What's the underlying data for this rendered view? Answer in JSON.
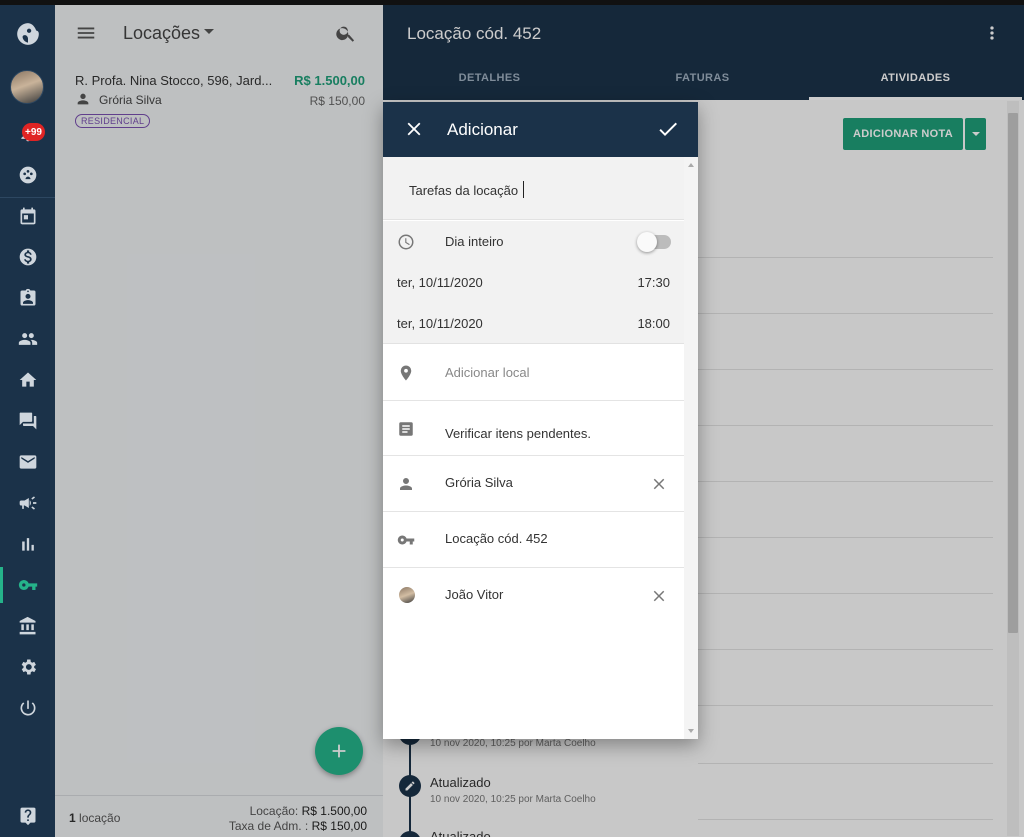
{
  "sidebar": {
    "notifications_badge": "+99",
    "active_item": "locacoes"
  },
  "list": {
    "title": "Locações",
    "items": [
      {
        "address": "R. Profa. Nina Stocco, 596, Jard...",
        "price": "R$ 1.500,00",
        "person": "Grória Silva",
        "fee": "R$ 150,00",
        "tag": "RESIDENCIAL"
      }
    ],
    "footer": {
      "count_number": "1",
      "count_label": "locação",
      "rent_label": "Locação:",
      "rent_value": "R$ 1.500,00",
      "fee_label": "Taxa de Adm. :",
      "fee_value": "R$ 150,00"
    }
  },
  "detail": {
    "title": "Locação cód. 452",
    "tabs": [
      "DETALHES",
      "FATURAS",
      "ATIVIDADES"
    ],
    "active_tab": "ATIVIDADES",
    "add_note_label": "ADICIONAR NOTA",
    "timeline": [
      {
        "title": "",
        "meta": "10 nov 2020, 10:25 por Marta Coelho"
      },
      {
        "title": "Atualizado",
        "meta": "10 nov 2020, 10:25 por Marta Coelho"
      },
      {
        "title": "Atualizado",
        "meta": ""
      }
    ]
  },
  "dialog": {
    "title": "Adicionar",
    "task_title_value": "Tarefas da locação",
    "all_day_label": "Dia inteiro",
    "all_day_on": false,
    "start_date": "ter, 10/11/2020",
    "start_time": "17:30",
    "end_date": "ter, 10/11/2020",
    "end_time": "18:00",
    "location_placeholder": "Adicionar local",
    "description": "Verificar itens pendentes.",
    "contact": "Grória Silva",
    "linked": "Locação cód. 452",
    "assignee": "João Vitor"
  },
  "colors": {
    "navy": "#1b3249",
    "accent": "#25b38a",
    "price_green": "#1f9e78",
    "tag_purple": "#7a4fb0",
    "badge_red": "#e02424"
  },
  "icons": [
    "logo-icon",
    "bell-icon",
    "palette-icon",
    "calendar-icon",
    "dollar-icon",
    "clipboard-icon",
    "people-icon",
    "home-icon",
    "chat-icon",
    "mail-icon",
    "megaphone-icon",
    "bar-chart-icon",
    "key-icon",
    "bank-icon",
    "gear-icon",
    "power-icon",
    "help-icon",
    "menu-icon",
    "search-icon",
    "more-vert-icon",
    "close-icon",
    "check-icon",
    "clock-icon",
    "location-pin-icon",
    "notes-icon",
    "person-icon",
    "plus-icon",
    "pencil-icon"
  ]
}
